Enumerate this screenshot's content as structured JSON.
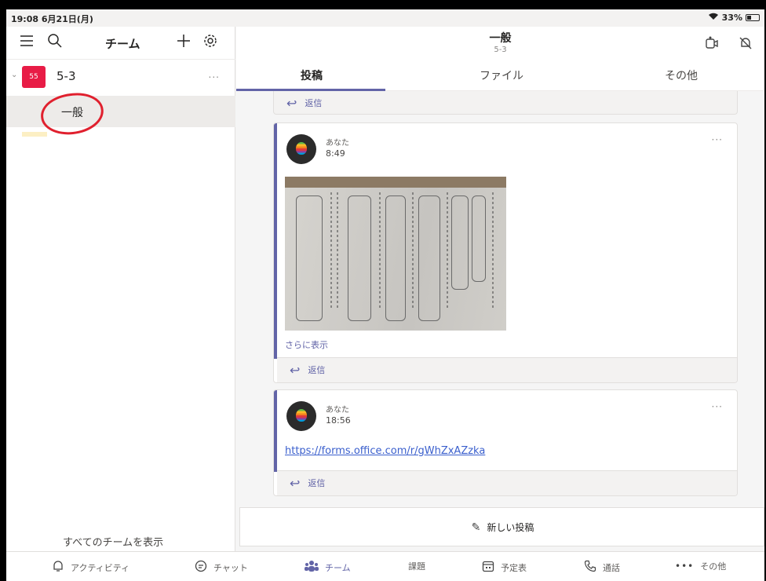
{
  "status_bar": {
    "time": "19:08 6月21日(月)",
    "battery": "33%"
  },
  "left_pane": {
    "title": "チーム",
    "team": {
      "avatar": "55",
      "name": "5-3",
      "more": "..."
    },
    "channel": {
      "name": "一般"
    },
    "show_all": "すべてのチームを表示"
  },
  "channel_header": {
    "title": "一般",
    "subtitle": "5-3"
  },
  "tabs": [
    {
      "label": "投稿"
    },
    {
      "label": "ファイル"
    },
    {
      "label": "その他"
    }
  ],
  "feed": {
    "reply_label": "返信",
    "posts": [
      {
        "author": "あなた",
        "time": "8:49",
        "show_more": "さらに表示"
      },
      {
        "author": "あなた",
        "time": "18:56",
        "link": "https://forms.office.com/r/gWhZxAZzka"
      }
    ]
  },
  "new_post": "新しい投稿",
  "bottom_nav": [
    {
      "label": "アクティビティ",
      "icon": "bell-icon"
    },
    {
      "label": "チャット",
      "icon": "chat-icon"
    },
    {
      "label": "チーム",
      "icon": "teams-icon"
    },
    {
      "label": "課題",
      "icon": "assignments-icon"
    },
    {
      "label": "予定表",
      "icon": "calendar-icon"
    },
    {
      "label": "通話",
      "icon": "phone-icon"
    },
    {
      "label": "その他",
      "icon": "more-icon"
    }
  ],
  "colors": {
    "accent": "#6264a7",
    "team_avatar": "#e81c46",
    "annotation": "#e0202e"
  }
}
